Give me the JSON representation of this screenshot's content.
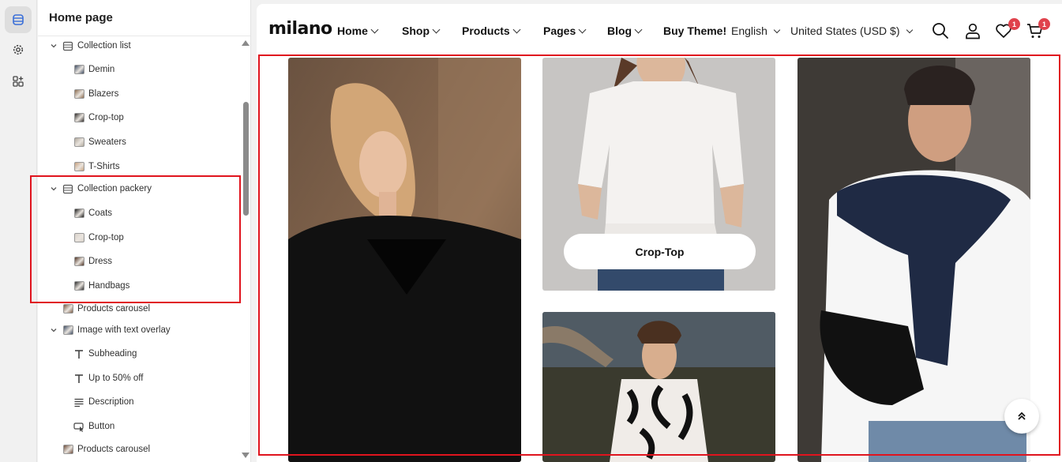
{
  "panel": {
    "title": "Home page",
    "tree": [
      {
        "label": "Collection list",
        "level": 0,
        "expanded": true,
        "icon": "section-icon"
      },
      {
        "label": "Demin",
        "level": 1,
        "icon": "image-thumb"
      },
      {
        "label": "Blazers",
        "level": 1,
        "icon": "image-thumb"
      },
      {
        "label": "Crop-top",
        "level": 1,
        "icon": "image-thumb"
      },
      {
        "label": "Sweaters",
        "level": 1,
        "icon": "image-thumb"
      },
      {
        "label": "T-Shirts",
        "level": 1,
        "icon": "image-thumb"
      },
      {
        "label": "Collection packery",
        "level": 0,
        "expanded": true,
        "icon": "section-icon"
      },
      {
        "label": "Coats",
        "level": 1,
        "icon": "image-thumb"
      },
      {
        "label": "Crop-top",
        "level": 1,
        "icon": "image-thumb"
      },
      {
        "label": "Dress",
        "level": 1,
        "icon": "image-thumb"
      },
      {
        "label": "Handbags",
        "level": 1,
        "icon": "image-thumb"
      },
      {
        "label": "Products carousel",
        "level": 0,
        "expanded": false,
        "icon": "image-thumb"
      },
      {
        "label": "Image with text overlay",
        "level": 0,
        "expanded": true,
        "icon": "image-thumb"
      },
      {
        "label": "Subheading",
        "level": 1,
        "icon": "text-icon"
      },
      {
        "label": "Up to 50% off",
        "level": 1,
        "icon": "text-icon"
      },
      {
        "label": "Description",
        "level": 1,
        "icon": "paragraph-icon"
      },
      {
        "label": "Button",
        "level": 1,
        "icon": "button-icon"
      },
      {
        "label": "Products carousel",
        "level": 0,
        "expanded": false,
        "icon": "image-thumb"
      }
    ]
  },
  "store": {
    "logo": "milano",
    "nav": [
      "Home",
      "Shop",
      "Products",
      "Pages",
      "Blog"
    ],
    "buy_theme": "Buy Theme!",
    "language": "English",
    "currency": "United States (USD $)",
    "wishlist_count": "1",
    "cart_count": "1",
    "featured_label": "Crop-Top"
  },
  "colors": {
    "highlight": "#e0141e",
    "badge": "#e0424c"
  }
}
